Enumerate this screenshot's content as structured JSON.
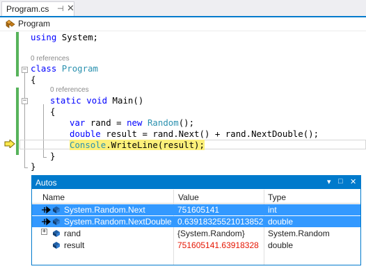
{
  "tab": {
    "title": "Program.cs",
    "pin": "⊣",
    "close": "✕"
  },
  "nav": {
    "label": "Program"
  },
  "code": {
    "line1_kw": "using",
    "line1_rest": " System;",
    "refs1": "0 references",
    "line2_kw": "class",
    "line2_type": "Program",
    "brace_open": "{",
    "refs2": "0 references",
    "line3_kw1": "static",
    "line3_kw2": "void",
    "line3_rest": " Main()",
    "brace_open2": "{",
    "line4_kw1": "var",
    "line4_a": " rand = ",
    "line4_kw2": "new",
    "line4_type": "Random",
    "line4_b": "();",
    "line5_kw": "double",
    "line5_rest": " result = rand.Next() + rand.NextDouble();",
    "line6_type": "Console",
    "line6_rest": ".WriteLine(result);",
    "brace_close2": "}",
    "brace_close": "}"
  },
  "autos": {
    "title": "Autos",
    "controls": {
      "dropdown": "▾",
      "restore": "□",
      "close": "✕"
    },
    "columns": [
      "Name",
      "Value",
      "Type"
    ],
    "rows": [
      {
        "name": "System.Random.Next",
        "value": "751605141",
        "type": "int",
        "selected": true
      },
      {
        "name": "System.Random.NextDouble",
        "value": "0.63918325521013852",
        "type": "double",
        "selected": true
      },
      {
        "name": "rand",
        "value": "{System.Random}",
        "type": "System.Random",
        "expand": "+"
      },
      {
        "name": "result",
        "value": "751605141.63918328",
        "type": "double",
        "changed": true
      }
    ]
  },
  "colors": {
    "accent": "#007acc",
    "selection": "#3399ff",
    "keyword": "#0000ff",
    "type": "#2b91af",
    "changed_value": "#e51400",
    "highlight": "#fcf07a",
    "change_bar": "#57b35b"
  },
  "icons": [
    "pin-icon",
    "close-icon",
    "class-icon",
    "execution-arrow-icon",
    "pin-to-source-icon",
    "field-icon",
    "expand-icon"
  ]
}
